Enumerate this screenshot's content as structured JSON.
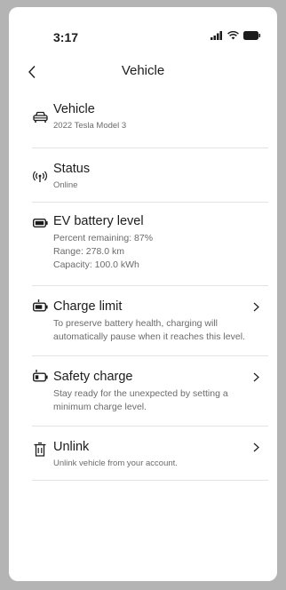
{
  "status_bar": {
    "time": "3:17"
  },
  "header": {
    "title": "Vehicle"
  },
  "items": [
    {
      "title": "Vehicle",
      "subtitle": "2022 Tesla Model 3",
      "icon": "car-icon"
    },
    {
      "title": "Status",
      "subtitle": "Online",
      "icon": "signal-icon"
    },
    {
      "title": "EV battery level",
      "lines": [
        "Percent remaining: 87%",
        "Range: 278.0 km",
        "Capacity: 100.0 kWh"
      ],
      "icon": "battery-icon"
    },
    {
      "title": "Charge limit",
      "description": "To preserve battery health, charging will automatically pause when it reaches this level.",
      "icon": "battery-charge-limit-icon"
    },
    {
      "title": "Safety charge",
      "description": "Stay ready for the unexpected by setting a minimum charge level.",
      "icon": "battery-safety-icon"
    },
    {
      "title": "Unlink",
      "subtitle": "Unlink vehicle from your account.",
      "icon": "trash-icon"
    }
  ]
}
